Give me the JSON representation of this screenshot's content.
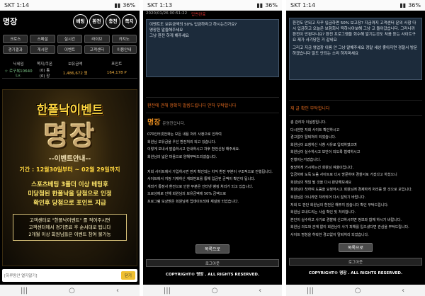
{
  "panel1": {
    "status_time": "SKT 1:14",
    "status_right": "36%",
    "logo": "명장",
    "circle_buttons": [
      "베팅",
      "환전",
      "충전",
      "쪽지"
    ],
    "menu": [
      "크로스",
      "스페셜",
      "실시간",
      "라이브",
      "카지노",
      "경기결과",
      "게시판",
      "이벤트",
      "고객센터",
      "이용안내"
    ],
    "info_headers": [
      "닉네임",
      "쪽지/쿠폰",
      "보유금액",
      "포인트"
    ],
    "info_values": {
      "nickname": "☆ 로구복10640 Lv.",
      "coupon_a": "(0) 통",
      "coupon_b": "(0) 장",
      "money": "1,486,672 원",
      "points": "164,178 P"
    },
    "promo": {
      "title": "한폴낙이벤트",
      "big": "명장",
      "subtitle": "--이벤트안내--",
      "date": "기간 : 12월30일부터 ~ 02월 29일까지",
      "lines": [
        "스포츠베팅 3폴더 이상 베팅후",
        "미당첨된 한폴낙을 당첨으로 인정",
        "확인후 당첨으로 포인트 지급"
      ],
      "box_lines": [
        "고객센터로 \"한폴낙이벤트\" 를 적어주시면",
        "고객센터에서 경기종료 후 순서대로 됩니다",
        "2개월 이상 회원님들은 이벤트 참여 불가능"
      ]
    },
    "chat_placeholder": "[하루동안 열지않기]",
    "chat_send": "닫기"
  },
  "panel2": {
    "status_time": "SKT 1:13",
    "status_right": "36%",
    "top_date": "2020/01/26 00:51:22",
    "top_status": "답변완료",
    "question_lines": [
      "이벤트도 보유금액의 50% 입금하라고 하시는건가요?",
      "명장한 말들해주세요",
      "그냥 환전 하게 해주세요"
    ],
    "answer_label": "환전에 관해 정확히 말씀드립니다 안하 부탁합니다",
    "answer_title": "명장",
    "answer_title_hint": "운영진입니다.",
    "answer_lines": [
      "070인터넷전화는 모든 내용 처리 사정으로 인하여",
      "회원님 보유금을 우선 환전처리 되고 있습니다.",
      "이렇게 보내서 말씀하시고 안내하시고 차후 환전신청 해주세요.",
      "회원님의 넓은 마음으로 양해부탁드리겠습니다.",
      "",
      "저희 사이트에서 가입하시면 먼저 확인되는 차익 환전 부분이 구조적으로 진행됩니다.",
      "사이트에서 지정 기재하신 계좌번호를 통해 입금된 금액이 확인이 됩니다.",
      "계좌가 통장사 환전으로 인한 부분은 인터넷 뱅킹 처리가 되고 있습니다.",
      "오로성에로 인해 회원님의 보유금액에 50% 금액으로",
      "프로그램 보상받은 회원님께 업데이트되며 재설정 되었습니다."
    ],
    "confirm_label": "목록으로",
    "logout_label": "로그아웃",
    "copyright": "COPYRIGHT© 명장 . ALL RIGHTS RESERVED."
  },
  "panel3": {
    "status_time": "SKT 1:14",
    "status_right": "36%",
    "question_lines": [
      "환전도 안되고 자꾸 입금하면 50% 보고장? 지금까지 고객센터 문의 사항 다시 입금하고 오늘은 보험회사 딱하시아보해 그냥 고 돌아갔습니다. 그러니까 환전이 안된다니요? 환전 프로그램을 회수해 알기는것도 처음 듣는 사이트구요 제가 사기당한 거 같네요",
      "그리고 지금 영업장 이름 안 그냥 말해주세요 정말 세상 좋아지면 경찰서 방문하겠습니다 알도 안되는 소리 하지마세요"
    ],
    "answer_label": "재 글 확인 부탁합니다",
    "answer_lines": [
      "총 관리자 이실장입니다.",
      "다시한번 저희 사이트 확인하시고",
      "경고없이 탈퇴처리 되었습니다.",
      "회원님이 요청하신 사항 사유로 입력하였으며",
      "회원님이 실수하시고 보안이 되도록 협력하시고",
      "진행이는거였습니다.",
      "정당하게 거시하는건 회원님 여울이입니다.",
      "입금처에 도둑 도움 사이트로 다시 방문하여 경찰서로 가겠다고 하셨으니",
      "회원님의 책임 될 것을 다시 판단해보세요",
      "회원님이 착하여 도움을 요청하시고 회원님께 경제하게 처리를 할 것으로 보입니다.",
      "회원님은 아니라면 처리되어 다시 잘되기 바랍니다.",
      "저희 도 판단 회원님의 환전은 해주지 않습니다 확인 부탁드립니다.",
      "회원님 보내드리는 사실 확인 및 처리합니다.",
      "본인이 실수하고 사기로 경찰에 신고하시려면 정보와 함께 하시기 바랍니다.",
      "회원님 의도와 관계 없이 회원님이 사기 피해를 입으셨다면 관심을 부탁드립니다.",
      "사이트 명칭을 허락한 경고없이 탈퇴처리 되었습니다."
    ],
    "confirm_label": "목록으로",
    "logout_label": "로그아웃",
    "copyright": "COPYRIGHT© 명장 . ALL RIGHTS RESERVED."
  }
}
